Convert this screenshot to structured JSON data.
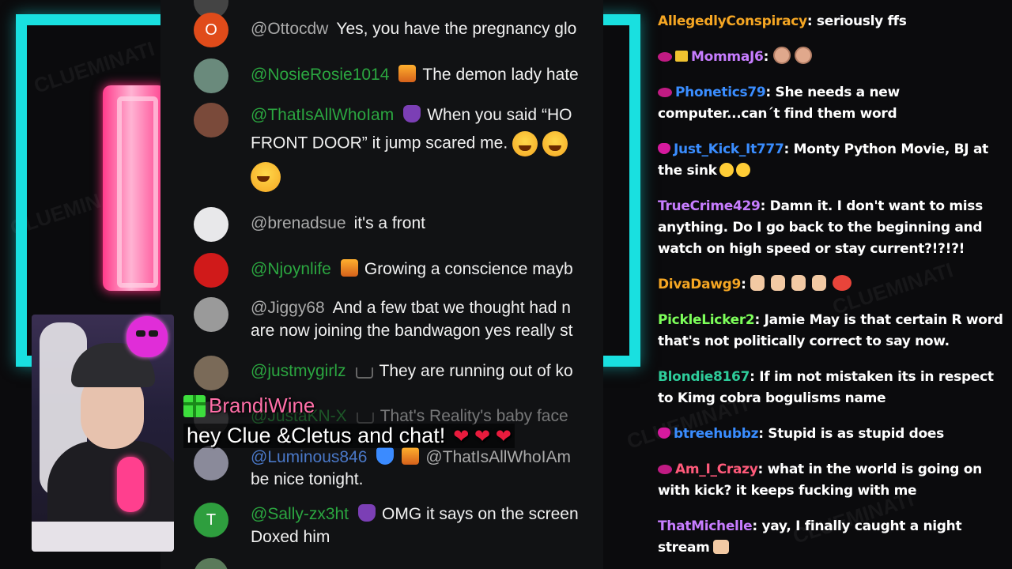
{
  "watermark": "CLUEMINATI",
  "yt_chat": [
    {
      "avatar_letter": "O",
      "avatar_color": "#e04b1a",
      "user": "@Ottocdw",
      "member": false,
      "badges": [],
      "text": "Yes, you have the pregnancy glo"
    },
    {
      "avatar_letter": "",
      "avatar_color": "#6a8a7c",
      "user": "@NosieRosie1014",
      "member": true,
      "badges": [
        "nat"
      ],
      "text": "The demon lady hate"
    },
    {
      "avatar_letter": "",
      "avatar_color": "#7a4a3a",
      "user": "@ThatIsAllWhoIam",
      "member": true,
      "badges": [
        "purple"
      ],
      "text": "When you said “HO",
      "text2": "FRONT DOOR” it jump scared me."
    },
    {
      "avatar_letter": "",
      "avatar_color": "#e8e8ea",
      "user": "@brenadsue",
      "member": false,
      "badges": [],
      "text": "it's a front"
    },
    {
      "avatar_letter": "",
      "avatar_color": "#d01a1a",
      "user": "@Njoynlife",
      "member": true,
      "badges": [
        "nat"
      ],
      "text": "Growing a conscience mayb"
    },
    {
      "avatar_letter": "",
      "avatar_color": "#9a9a9a",
      "user": "@Jiggy68",
      "member": false,
      "badges": [],
      "text": "And a few tbat we thought had n",
      "text2": "are now joining the bandwagon yes really st"
    },
    {
      "avatar_letter": "",
      "avatar_color": "#7a6a58",
      "user": "@justmygirlz",
      "member": true,
      "badges": [
        "crown"
      ],
      "text": "They are running out of ko"
    },
    {
      "avatar_letter": "",
      "avatar_color": "#555",
      "user": "@JustaKN-X",
      "member": true,
      "badges": [
        "crown"
      ],
      "text": "That's Reality's baby face"
    },
    {
      "avatar_letter": "",
      "avatar_color": "#8a8a9a",
      "user": "@Luminous846",
      "member": true,
      "badges": [
        "shield",
        "nat"
      ],
      "text": "@ThatIsAllWhoIAm",
      "text2": "be nice tonight."
    },
    {
      "avatar_letter": "T",
      "avatar_color": "#2e9e3e",
      "user": "@Sally-zx3ht",
      "member": true,
      "badges": [
        "purple"
      ],
      "text": "OMG it says on the screen",
      "text2": "Doxed him"
    }
  ],
  "alert": {
    "name": "BrandiWine",
    "message": "hey Clue &Cletus and chat!",
    "hearts": "❤ ❤ ❤"
  },
  "kick_chat": [
    {
      "badge": "",
      "user": "AllegedlyConspiracy",
      "color": "#f5a623",
      "text": ": seriously ffs"
    },
    {
      "badge": "eye+gift",
      "user": "MommaJ6",
      "color": "#c77dff",
      "text": ": ",
      "emotes": "faces"
    },
    {
      "badge": "eye",
      "user": "Phonetics79",
      "color": "#3a8dff",
      "text": ": She needs a new computer...can´t find them word"
    },
    {
      "badge": "mask",
      "user": "Just_Kick_It777",
      "color": "#3a8dff",
      "text": ": Monty Python Movie, BJ at the sink",
      "emotes": "tongue"
    },
    {
      "badge": "",
      "user": "TrueCrime429",
      "color": "#c77dff",
      "text": ": Damn it. I don't want to miss anything. Do I go back to the beginning and watch on high speed or stay current?!?!?!"
    },
    {
      "badge": "",
      "user": "DivaDawg9",
      "color": "#f5a623",
      "text": ": ",
      "emotes": "thumbs"
    },
    {
      "badge": "",
      "user": "PickleLicker2",
      "color": "#7dff5a",
      "text": ": Jamie May is that certain R word that's not politically correct to say now."
    },
    {
      "badge": "",
      "user": "Blondie8167",
      "color": "#2ecc9a",
      "text": ": If im not mistaken its in respect to Kimg cobra bogulisms name"
    },
    {
      "badge": "mask",
      "user": "btreehubbz",
      "color": "#3a8dff",
      "text": ": Stupid is as stupid does"
    },
    {
      "badge": "eye",
      "user": "Am_I_Crazy",
      "color": "#ff5a7a",
      "text": ": what in the world is going on with kick? it keeps fucking with me"
    },
    {
      "badge": "",
      "user": "ThatMichelle",
      "color": "#c77dff",
      "text": ": yay, I finally caught a night stream",
      "emotes": "praying"
    }
  ]
}
